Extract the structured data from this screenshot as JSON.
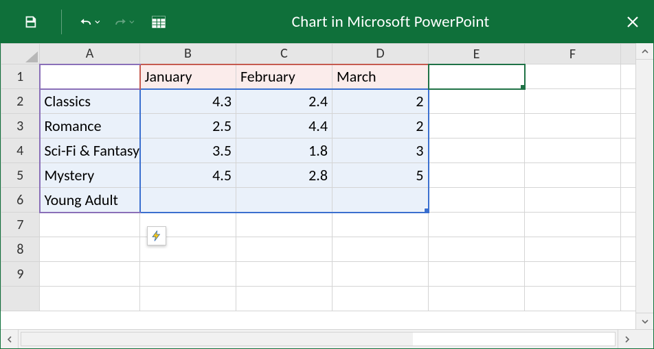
{
  "titlebar": {
    "title": "Chart in Microsoft PowerPoint"
  },
  "columns": [
    "A",
    "B",
    "C",
    "D",
    "E",
    "F"
  ],
  "rows": [
    "1",
    "2",
    "3",
    "4",
    "5",
    "6",
    "7",
    "8",
    "9"
  ],
  "sheet": {
    "B1": "January",
    "C1": "February",
    "D1": "March",
    "A2": "Classics",
    "B2": "4.3",
    "C2": "2.4",
    "D2": "2",
    "A3": "Romance",
    "B3": "2.5",
    "C3": "4.4",
    "D3": "2",
    "A4": "Sci-Fi & Fantasy",
    "B4": "3.5",
    "C4": "1.8",
    "D4": "3",
    "A5": "Mystery",
    "B5": "4.5",
    "C5": "2.8",
    "D5": "5",
    "A6": "Young Adult"
  },
  "chart_data": {
    "type": "bar",
    "categories": [
      "Classics",
      "Romance",
      "Sci-Fi & Fantasy",
      "Mystery",
      "Young Adult"
    ],
    "series": [
      {
        "name": "January",
        "values": [
          4.3,
          2.5,
          3.5,
          4.5,
          null
        ]
      },
      {
        "name": "February",
        "values": [
          2.4,
          4.4,
          1.8,
          2.8,
          null
        ]
      },
      {
        "name": "March",
        "values": [
          2,
          2,
          3,
          5,
          null
        ]
      }
    ]
  }
}
